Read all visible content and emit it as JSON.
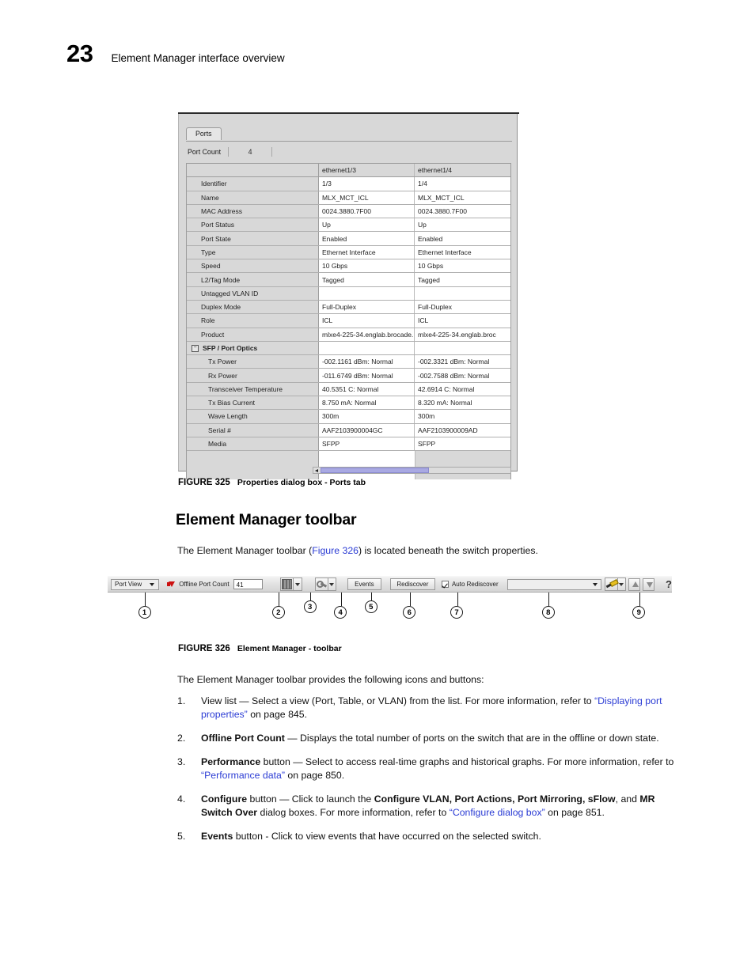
{
  "page": {
    "number": "23",
    "running_head": "Element Manager interface overview"
  },
  "figure325": {
    "caption_tag": "FIGURE 325",
    "caption_text": "Properties dialog box - Ports tab",
    "dialog": {
      "tab_label": "Ports",
      "port_count_label": "Port Count",
      "port_count_value": "4",
      "columns": [
        "",
        "ethernet1/3",
        "ethernet1/4"
      ],
      "rows": [
        {
          "label": "Identifier",
          "indent": "none",
          "values": [
            "1/3",
            "1/4"
          ]
        },
        {
          "label": "Name",
          "indent": "none",
          "values": [
            "MLX_MCT_ICL",
            "MLX_MCT_ICL"
          ]
        },
        {
          "label": "MAC Address",
          "indent": "none",
          "values": [
            "0024.3880.7F00",
            "0024.3880.7F00"
          ]
        },
        {
          "label": "Port Status",
          "indent": "none",
          "values": [
            "Up",
            "Up"
          ]
        },
        {
          "label": "Port State",
          "indent": "none",
          "values": [
            "Enabled",
            "Enabled"
          ]
        },
        {
          "label": "Type",
          "indent": "none",
          "values": [
            "Ethernet Interface",
            "Ethernet Interface"
          ]
        },
        {
          "label": "Speed",
          "indent": "none",
          "values": [
            "10 Gbps",
            "10 Gbps"
          ]
        },
        {
          "label": "L2/Tag Mode",
          "indent": "none",
          "values": [
            "Tagged",
            "Tagged"
          ]
        },
        {
          "label": "Untagged VLAN ID",
          "indent": "none",
          "values": [
            "",
            ""
          ]
        },
        {
          "label": "Duplex Mode",
          "indent": "none",
          "values": [
            "Full-Duplex",
            "Full-Duplex"
          ]
        },
        {
          "label": "Role",
          "indent": "none",
          "values": [
            "ICL",
            "ICL"
          ]
        },
        {
          "label": "Product",
          "indent": "none",
          "values": [
            "mlxe4-225-34.englab.brocade....",
            "mlxe4-225-34.englab.broc"
          ]
        },
        {
          "label": "SFP / Port Optics",
          "indent": "group",
          "values": [
            "",
            ""
          ]
        },
        {
          "label": "Tx Power",
          "indent": "child",
          "values": [
            "-002.1161 dBm: Normal",
            "-002.3321 dBm: Normal"
          ]
        },
        {
          "label": "Rx Power",
          "indent": "child",
          "values": [
            "-011.6749 dBm: Normal",
            "-002.7588 dBm: Normal"
          ]
        },
        {
          "label": "Transceiver Temperature",
          "indent": "child",
          "values": [
            "40.5351 C: Normal",
            "42.6914 C: Normal"
          ]
        },
        {
          "label": "Tx Bias Current",
          "indent": "child",
          "values": [
            "8.750 mA: Normal",
            "8.320 mA: Normal"
          ]
        },
        {
          "label": "Wave Length",
          "indent": "child",
          "values": [
            "300m",
            "300m"
          ]
        },
        {
          "label": "Serial #",
          "indent": "child",
          "values": [
            "AAF2103900004GC",
            "AAF2103900009AD"
          ]
        },
        {
          "label": "Media",
          "indent": "child",
          "values": [
            "SFPP",
            "SFPP"
          ]
        }
      ],
      "group_toggle_glyph": "−"
    }
  },
  "section": {
    "heading": "Element Manager toolbar",
    "intro_before": "The Element Manager toolbar (",
    "intro_link": "Figure 326",
    "intro_after": ") is located beneath the switch properties.",
    "after_figure_para": "The Element Manager toolbar provides the following icons and buttons:"
  },
  "figure326": {
    "caption_tag": "FIGURE 326",
    "caption_text": "Element Manager - toolbar",
    "toolbar": {
      "view_list_value": "Port View",
      "offline_port_count_label": "Offline Port Count",
      "offline_port_count_value": "41",
      "events_button": "Events",
      "rediscover_button": "Rediscover",
      "auto_rediscover_label": "Auto Rediscover",
      "auto_rediscover_checked": true,
      "search_value": "",
      "help_glyph": "?"
    },
    "callouts": [
      "1",
      "2",
      "3",
      "4",
      "5",
      "6",
      "7",
      "8",
      "9"
    ]
  },
  "list": {
    "items": [
      {
        "num": "1.",
        "parts": [
          {
            "t": "View list — Select a view (Port, Table, or VLAN) from the list. For more information, refer to ",
            "style": "normal"
          },
          {
            "t": "“Displaying port properties”",
            "style": "link"
          },
          {
            "t": " on page 845.",
            "style": "normal"
          }
        ]
      },
      {
        "num": "2.",
        "parts": [
          {
            "t": "Offline Port Count",
            "style": "bold"
          },
          {
            "t": " — Displays the total number of ports on the switch that are in the offline or down state.",
            "style": "normal"
          }
        ]
      },
      {
        "num": "3.",
        "parts": [
          {
            "t": "Performance",
            "style": "bold"
          },
          {
            "t": " button — Select to access real-time graphs and historical graphs. For more information, refer to ",
            "style": "normal"
          },
          {
            "t": "“Performance data”",
            "style": "link"
          },
          {
            "t": " on page 850.",
            "style": "normal"
          }
        ]
      },
      {
        "num": "4.",
        "parts": [
          {
            "t": "Configure",
            "style": "bold"
          },
          {
            "t": " button — Click to launch the ",
            "style": "normal"
          },
          {
            "t": "Configure VLAN, Port Actions, Port Mirroring, sFlow",
            "style": "bold"
          },
          {
            "t": ", and ",
            "style": "normal"
          },
          {
            "t": "MR Switch Over",
            "style": "bold"
          },
          {
            "t": " dialog boxes. For more information, refer to ",
            "style": "normal"
          },
          {
            "t": "“Configure dialog box”",
            "style": "link"
          },
          {
            "t": " on page 851.",
            "style": "normal"
          }
        ]
      },
      {
        "num": "5.",
        "parts": [
          {
            "t": "Events",
            "style": "bold"
          },
          {
            "t": " button - Click to view events that have occurred on the selected switch.",
            "style": "normal"
          }
        ]
      }
    ]
  },
  "colors": {
    "link": "#2a3bd4",
    "dialog_bg": "#d8d8d8",
    "scrollbar_thumb": "#a9a9e2",
    "red_arrow": "#cc1111"
  }
}
